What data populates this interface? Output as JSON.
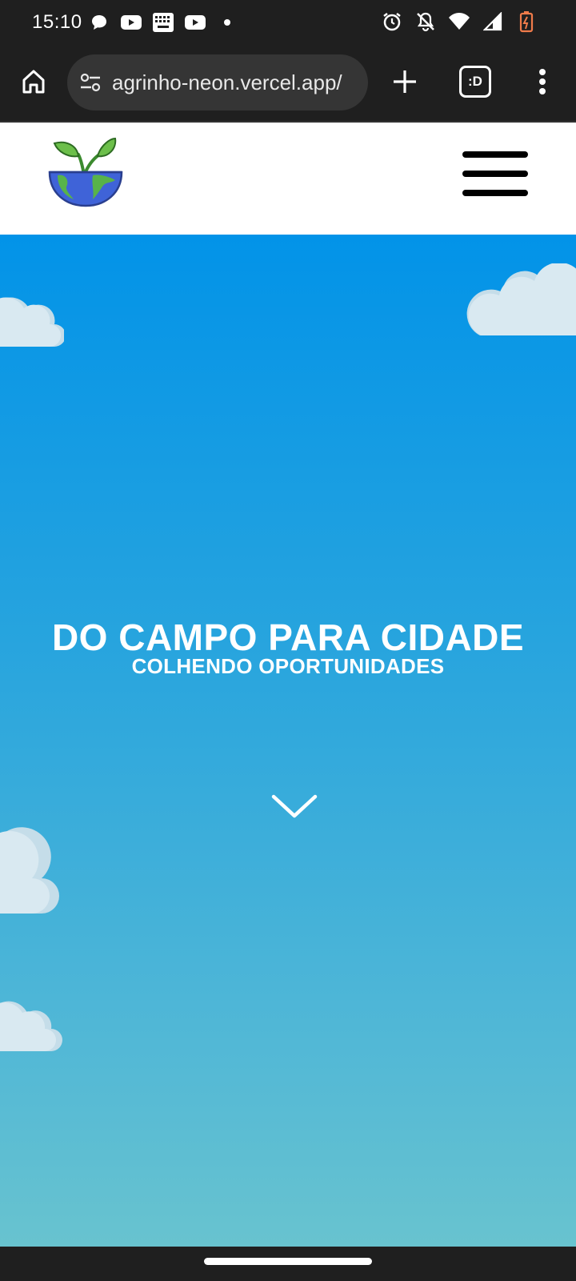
{
  "status_bar": {
    "time": "15:10",
    "left_icons": [
      "chat-bubble-icon",
      "youtube-icon",
      "keyboard-icon",
      "youtube-icon",
      "dot-icon"
    ],
    "right_icons": [
      "alarm-icon",
      "notifications-off-icon",
      "wifi-icon",
      "signal-icon",
      "battery-icon"
    ]
  },
  "browser": {
    "url": "agrinho-neon.vercel.app/",
    "tab_switcher_label": ":D",
    "icons": [
      "home-icon",
      "site-settings-icon",
      "plus-icon",
      "more-vert-icon"
    ]
  },
  "site_header": {
    "logo_icon": "plant-globe-logo",
    "menu_icon": "hamburger-icon"
  },
  "hero": {
    "title": "DO CAMPO PARA CIDADE",
    "subtitle": "COLHENDO OPORTUNIDADES",
    "scroll_icon": "chevron-down-icon",
    "gradient_top": "#0293e8",
    "gradient_bottom": "#68c3cf",
    "cloud_color": "#d9e9f1"
  }
}
